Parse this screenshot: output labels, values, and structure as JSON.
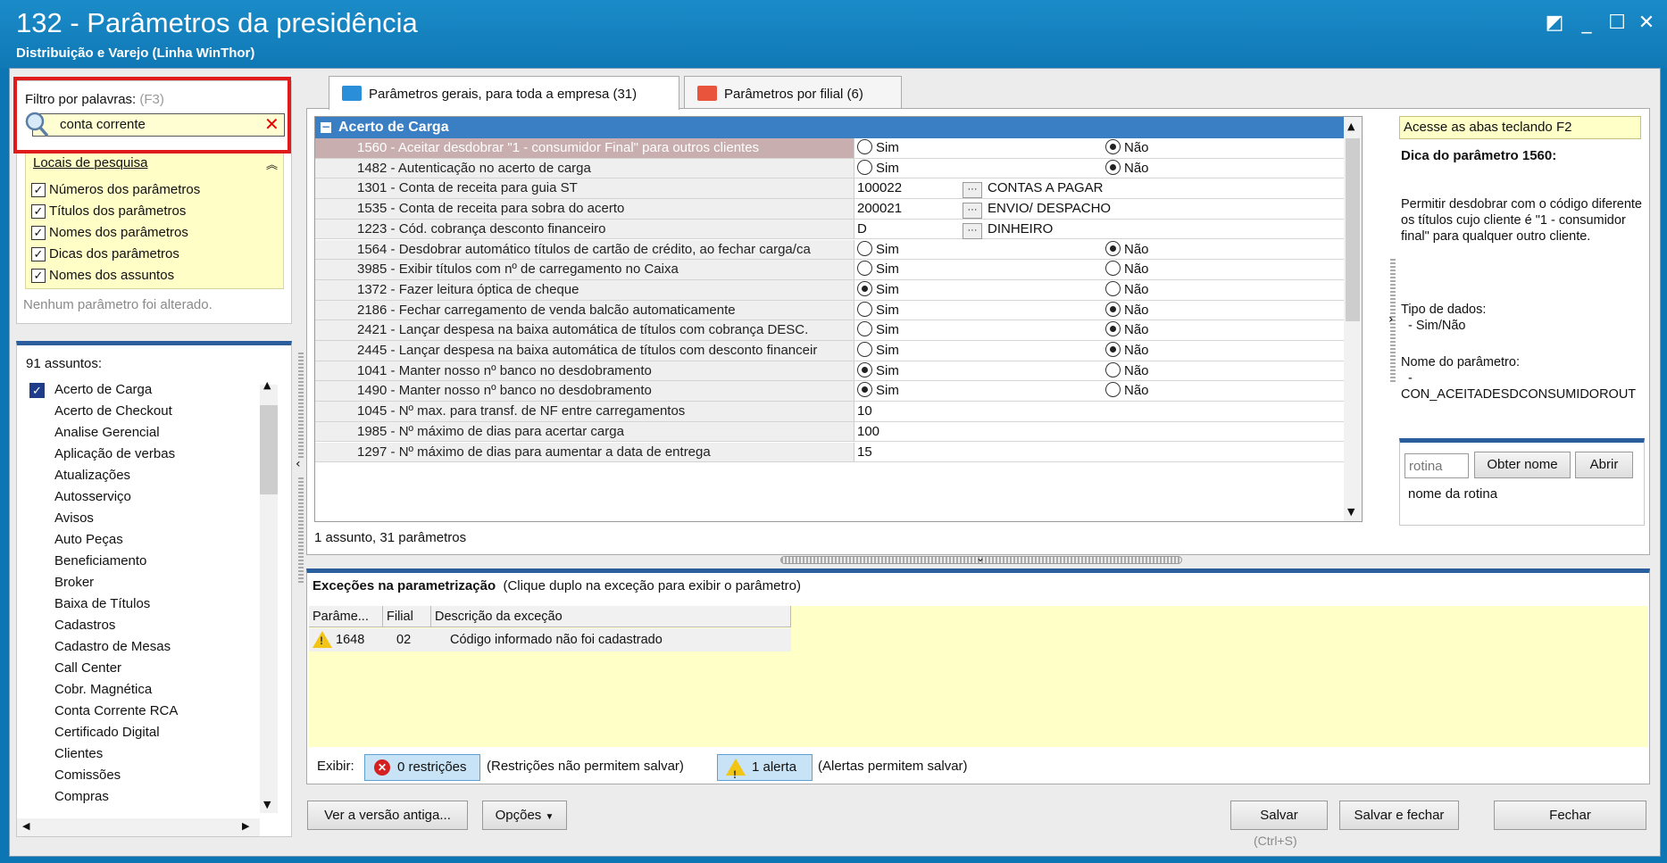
{
  "window": {
    "title": "132 - Parâmetros da presidência",
    "subtitle": "Distribuição e Varejo (Linha WinThor)"
  },
  "filter": {
    "label": "Filtro por palavras:",
    "hotkey": "(F3)",
    "value": "conta corrente",
    "locais_header": "Locais de pesquisa",
    "options": [
      {
        "label": "Números dos parâmetros",
        "checked": true
      },
      {
        "label": "Títulos dos parâmetros",
        "checked": true
      },
      {
        "label": "Nomes dos parâmetros",
        "checked": true
      },
      {
        "label": "Dicas dos parâmetros",
        "checked": true
      },
      {
        "label": "Nomes dos assuntos",
        "checked": true
      }
    ],
    "status": "Nenhum parâmetro foi alterado."
  },
  "assuntos": {
    "title": "91 assuntos:",
    "items": [
      "Acerto de Carga",
      "Acerto de Checkout",
      "Analise Gerencial",
      "Aplicação de verbas",
      "Atualizações",
      "Autosserviço",
      "Avisos",
      "Auto Peças",
      "Beneficiamento",
      "Broker",
      "Baixa de Títulos",
      "Cadastros",
      "Cadastro de Mesas",
      "Call Center",
      "Cobr. Magnética",
      "Conta Corrente RCA",
      "Certificado Digital",
      "Clientes",
      "Comissões",
      "Compras"
    ]
  },
  "tabs": [
    {
      "label": "Parâmetros gerais, para toda a empresa (31)",
      "active": true,
      "color": "#2a8fd8"
    },
    {
      "label": "Parâmetros por filial (6)",
      "active": false,
      "color": "#e8553c"
    }
  ],
  "grid": {
    "group": "Acerto de Carga",
    "yes": "Sim",
    "no": "Não",
    "rows": [
      {
        "name": "1560 - Aceitar desdobrar \"1 - consumidor Final\" para outros clientes",
        "type": "bool",
        "value": "Não"
      },
      {
        "name": "1482 - Autenticação no acerto de carga",
        "type": "bool",
        "value": "Não"
      },
      {
        "name": "1301 - Conta de receita para guia ST",
        "type": "lookup",
        "code": "100022",
        "desc": "CONTAS A PAGAR"
      },
      {
        "name": "1535 - Conta de receita para sobra do acerto",
        "type": "lookup",
        "code": "200021",
        "desc": "ENVIO/ DESPACHO"
      },
      {
        "name": "1223 - Cód. cobrança desconto financeiro",
        "type": "lookup",
        "code": "D",
        "desc": "DINHEIRO"
      },
      {
        "name": "1564 - Desdobrar automático títulos de cartão de crédito, ao fechar carga/ca",
        "type": "bool",
        "value": "Não"
      },
      {
        "name": "3985 - Exibir títulos com nº de carregamento no Caixa",
        "type": "bool",
        "value": "none"
      },
      {
        "name": "1372 - Fazer leitura óptica de cheque",
        "type": "bool",
        "value": "Sim"
      },
      {
        "name": "2186 - Fechar carregamento de venda balcão automaticamente",
        "type": "bool",
        "value": "Não"
      },
      {
        "name": "2421 - Lançar despesa na baixa automática de títulos com cobrança DESC.",
        "type": "bool",
        "value": "Não"
      },
      {
        "name": "2445 - Lançar despesa na baixa automática de títulos com desconto financeir",
        "type": "bool",
        "value": "Não"
      },
      {
        "name": "1041 - Manter nosso nº banco no desdobramento",
        "type": "bool",
        "value": "Sim"
      },
      {
        "name": "1490 - Manter nosso nº banco no desdobramento",
        "type": "bool",
        "value": "Sim"
      },
      {
        "name": "1045 - Nº max. para transf. de NF entre carregamentos",
        "type": "text",
        "code": "10"
      },
      {
        "name": "1985 - Nº máximo de dias para acertar carga",
        "type": "text",
        "code": "100"
      },
      {
        "name": "1297 - Nº máximo de dias para aumentar a data de entrega",
        "type": "text",
        "code": "15"
      }
    ],
    "status": "1 assunto, 31 parâmetros"
  },
  "help": {
    "hint": "Acesse as abas teclando F2",
    "title": "Dica do parâmetro 1560:",
    "body": "Permitir desdobrar com o código diferente os títulos cujo cliente é \"1 - consumidor final\" para qualquer outro cliente.",
    "type_label": "Tipo de dados:",
    "type_value": "- Sim/Não",
    "name_label": "Nome do parâmetro:",
    "name_dash": "-",
    "name_value": "CON_ACEITADESDCONSUMIDOROUT",
    "rotina_placeholder": "rotina",
    "obter_label": "Obter nome",
    "abrir_label": "Abrir",
    "rotina_caption": "nome da rotina"
  },
  "exceptions": {
    "title": "Exceções na parametrização",
    "hint": "(Clique duplo na exceção para exibir o parâmetro)",
    "columns": [
      "Parâme...",
      "Filial",
      "Descrição da exceção"
    ],
    "rows": [
      {
        "param": "1648",
        "filial": "02",
        "desc": "Código informado não foi cadastrado"
      }
    ],
    "exibir": "Exibir:",
    "restr_label": "0 restrições",
    "restr_note": "(Restrições não permitem salvar)",
    "alert_label": "1 alerta",
    "alert_note": "(Alertas permitem salvar)"
  },
  "footer": {
    "ver_label": "Ver a versão antiga...",
    "opcoes_label": "Opções",
    "salvar_label": "Salvar",
    "salvar_shortcut": "(Ctrl+S)",
    "salvar_fechar_label": "Salvar e fechar",
    "fechar_label": "Fechar"
  },
  "colors": {
    "titlebar": "#1b8cc9",
    "group_header": "#3a7fc4",
    "highlight_border": "#e01b1b",
    "note_yellow": "#ffffc8"
  }
}
